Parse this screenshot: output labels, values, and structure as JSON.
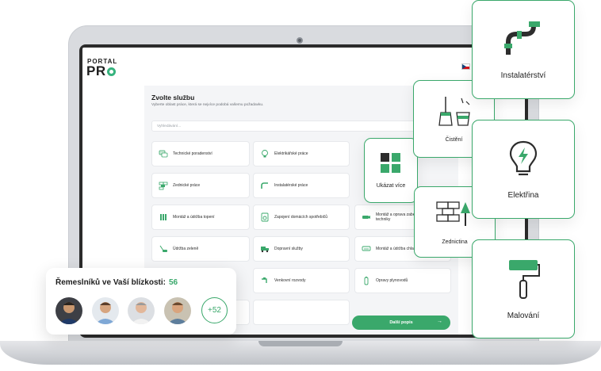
{
  "app": {
    "logo_top": "PORTAL",
    "logo_main": "PR"
  },
  "panel": {
    "title": "Zvolte službu",
    "subtitle": "Vyberte oblast práce, která se nejvíce podobá vašemu požadavku.",
    "search_placeholder": "Vyhledávání..."
  },
  "services": [
    {
      "label": "Technické poradenství",
      "icon": "chat-icon"
    },
    {
      "label": "Elektrikářské práce",
      "icon": "bulb-icon"
    },
    {
      "label": "Zednické práce",
      "icon": "bricks-icon"
    },
    {
      "label": "Instalatérské práce",
      "icon": "pipe-icon"
    },
    {
      "label": "Montáž a údržba topení",
      "icon": "radiator-icon"
    },
    {
      "label": "Zapojení domácích spotřebičů",
      "icon": "appliance-icon"
    },
    {
      "label": "Montáž a oprava zabezpečovací techniky",
      "icon": "camera-icon"
    },
    {
      "label": "Údržba zeleně",
      "icon": "mower-icon"
    },
    {
      "label": "Dopravní služby",
      "icon": "truck-icon"
    },
    {
      "label": "Montáž a údržba chladicí techniky",
      "icon": "ac-icon"
    },
    {
      "label": "Venkovní rozvody",
      "icon": "tap-icon"
    },
    {
      "label": "Opravy plynovodů",
      "icon": "gas-icon"
    }
  ],
  "next_button": {
    "label": "Další popis",
    "arrow": "→"
  },
  "cards": {
    "show_more": "Ukázat více",
    "cleaning": "Čistění",
    "masonry": "Zednictina",
    "plumbing": "Instalatérství",
    "electric": "Elektřina",
    "painting": "Malování"
  },
  "nearby": {
    "title": "Řemeslníků ve Vaší blízkosti:",
    "count": "56",
    "more": "+52"
  },
  "colors": {
    "accent": "#3aa86b",
    "text": "#1e1e1e"
  }
}
